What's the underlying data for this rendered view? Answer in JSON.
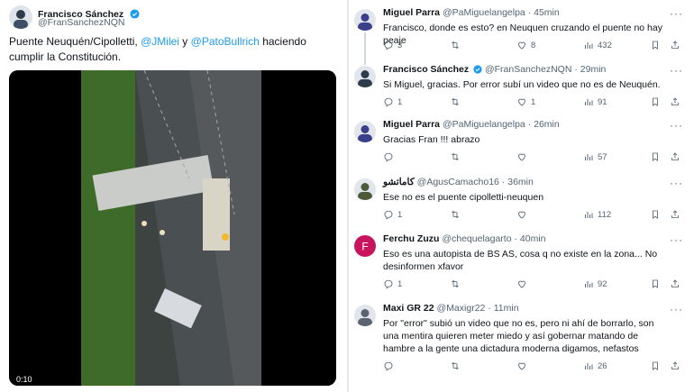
{
  "post": {
    "author_name": "Francisco Sánchez",
    "author_handle": "@FranSanchezNQN",
    "text_before": "Puente Neuquén/Cipolletti, ",
    "mention1": "@JMilei",
    "text_mid": " y ",
    "mention2": "@PatoBullrich",
    "text_after": " haciendo cumplir la Constitución.",
    "video_timecode": "0:10"
  },
  "replies": [
    {
      "name": "Miguel Parra",
      "handle": "@PaMiguelangelpa",
      "time": "45min",
      "text": "Francisco, donde es esto? en Neuquen cruzando el puente no hay peaje",
      "replies_count": "3",
      "retweets_count": "",
      "likes_count": "8",
      "views_count": "432",
      "avatar_color": "#3b3f8a"
    },
    {
      "name": "Francisco Sánchez",
      "handle": "@FranSanchezNQN",
      "time": "29min",
      "text": "Si Miguel, gracias. Por error subí un video que no es de Neuquén.",
      "replies_count": "1",
      "retweets_count": "",
      "likes_count": "1",
      "views_count": "91",
      "avatar_color": "#2d3b4a"
    },
    {
      "name": "Miguel Parra",
      "handle": "@PaMiguelangelpa",
      "time": "26min",
      "text": "Gracias Fran !!! abrazo",
      "replies_count": "",
      "retweets_count": "",
      "likes_count": "",
      "views_count": "57",
      "avatar_color": "#3b3f8a"
    },
    {
      "name": "كاماتشو",
      "handle": "@AgusCamacho16",
      "time": "36min",
      "text": "Ese no es el puente cipolletti-neuquen",
      "replies_count": "1",
      "retweets_count": "",
      "likes_count": "",
      "views_count": "112",
      "avatar_color": "#4d5a3a"
    },
    {
      "name": "Ferchu Zuzu",
      "handle": "@chequelagarto",
      "time": "40min",
      "text": "Eso es una autopista de BS AS, cosa q no existe en la zona... No desinformen xfavor",
      "replies_count": "1",
      "retweets_count": "",
      "likes_count": "",
      "views_count": "92",
      "avatar_color": "#c8145e",
      "avatar_letter": "F"
    },
    {
      "name": "Maxi GR 22",
      "handle": "@Maxigr22",
      "time": "11min",
      "text": "Por \"error\" subió un video que no es, pero ni ahí de borrarlo, son una mentira quieren meter miedo y así gobernar matando de hambre a la gente una dictadura moderna digamos, nefastos",
      "replies_count": "",
      "retweets_count": "",
      "likes_count": "",
      "views_count": "26",
      "avatar_color": "#5b6470"
    }
  ],
  "colors": {
    "link": "#1d9bf0",
    "secondary_text": "#536471",
    "verified": "#1d9bf0"
  }
}
